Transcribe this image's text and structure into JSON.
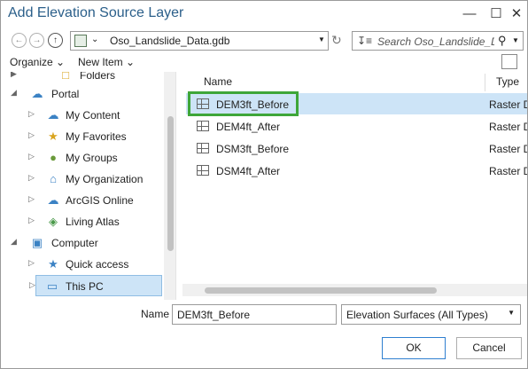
{
  "window": {
    "title": "Add Elevation Source Layer",
    "minimize_glyph": "—",
    "maximize_glyph": "☐",
    "close_glyph": "✕"
  },
  "address": {
    "path": "Oso_Landslide_Data.gdb",
    "search_placeholder": "Search Oso_Landslide_Data.gdb"
  },
  "toolbar": {
    "organize_label": "Organize ⌄",
    "new_item_label": "New Item ⌄"
  },
  "sidebar": {
    "items": [
      {
        "label": "Folders"
      },
      {
        "label": "Portal"
      },
      {
        "label": "My Content"
      },
      {
        "label": "My Favorites"
      },
      {
        "label": "My Groups"
      },
      {
        "label": "My Organization"
      },
      {
        "label": "ArcGIS Online"
      },
      {
        "label": "Living Atlas"
      },
      {
        "label": "Computer"
      },
      {
        "label": "Quick access"
      },
      {
        "label": "This PC"
      }
    ]
  },
  "filelist": {
    "columns": {
      "name": "Name",
      "type": "Type"
    },
    "rows": [
      {
        "name": "DEM3ft_Before",
        "type": "Raster Dataset",
        "selected": true
      },
      {
        "name": "DEM4ft_After",
        "type": "Raster Dataset",
        "selected": false
      },
      {
        "name": "DSM3ft_Before",
        "type": "Raster Dataset",
        "selected": false
      },
      {
        "name": "DSM4ft_After",
        "type": "Raster Dataset",
        "selected": false
      }
    ]
  },
  "footer": {
    "name_label": "Name",
    "name_value": "DEM3ft_Before",
    "filter_value": "Elevation Surfaces (All Types)",
    "ok_label": "OK",
    "cancel_label": "Cancel"
  },
  "colors": {
    "title": "#2b5f8a",
    "selection": "#cde4f7",
    "focus_frame": "#3ea639",
    "primary_button_border": "#2f7fd0"
  }
}
